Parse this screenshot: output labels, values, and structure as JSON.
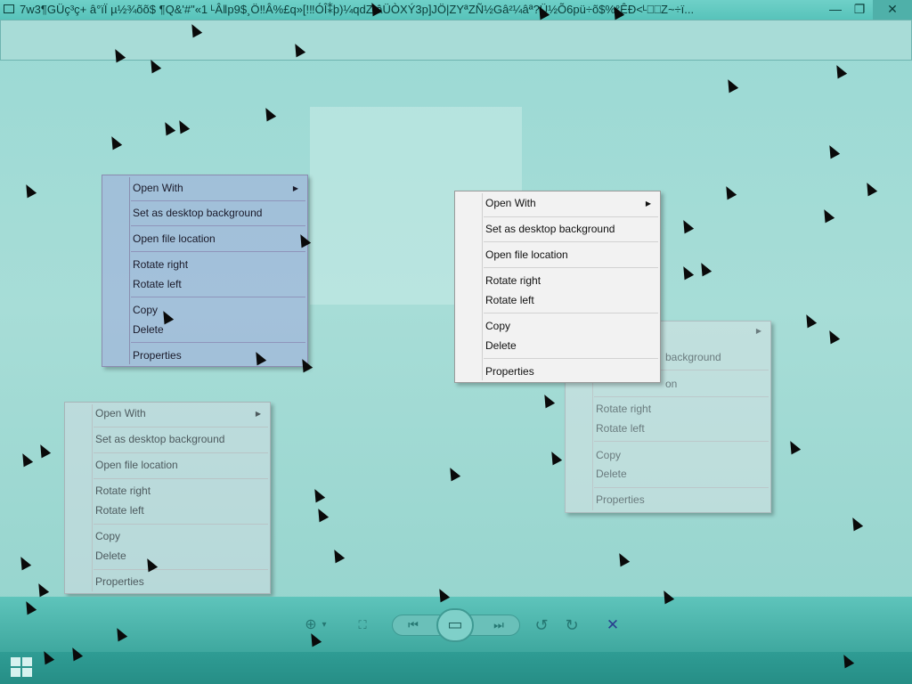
{
  "window": {
    "title": "7w3¶GÜç³ç+ â°ïÏ µ½¾õõ$   ¶Q&'#\"«1 ᴸÂ‖p9$¸Ö‼Â%£q»[!‼ÓÎ⁑þ)¼qdZ\\âÜÒXÝ3p]JÖ|ZYªZÑ½Gâ²¼âª?Ü½Õ6pü÷õ$%°ÊÐ<ᴸ⎕⎕Z~÷ï...",
    "minimize_glyph": "—",
    "maximize_glyph": "❐",
    "close_glyph": "✕"
  },
  "context_menu": {
    "open_with": "Open With",
    "set_background": "Set as desktop background",
    "open_location": "Open file location",
    "rotate_right": "Rotate right",
    "rotate_left": "Rotate left",
    "copy": "Copy",
    "delete": "Delete",
    "properties": "Properties",
    "submenu_arrow": "▶",
    "ghost_background_fragment": "background",
    "ghost_location_fragment": "on"
  },
  "toolbar": {
    "zoom_icon": "⊕",
    "zoom_arrow": "▾",
    "actual_size_icon": "⛶",
    "prev_icon": "⏮",
    "slideshow_icon": "▭",
    "next_icon": "⏭",
    "rotate_ccw_icon": "↺",
    "rotate_cw_icon": "↻",
    "delete_icon": "✕"
  },
  "colors": {
    "desktop": "#9ad9d4",
    "active_menu": "#f2f2f2",
    "toolbar": "#5ec4bb",
    "taskbar": "#2f9c94",
    "delete_accent": "#2a3f8f"
  }
}
